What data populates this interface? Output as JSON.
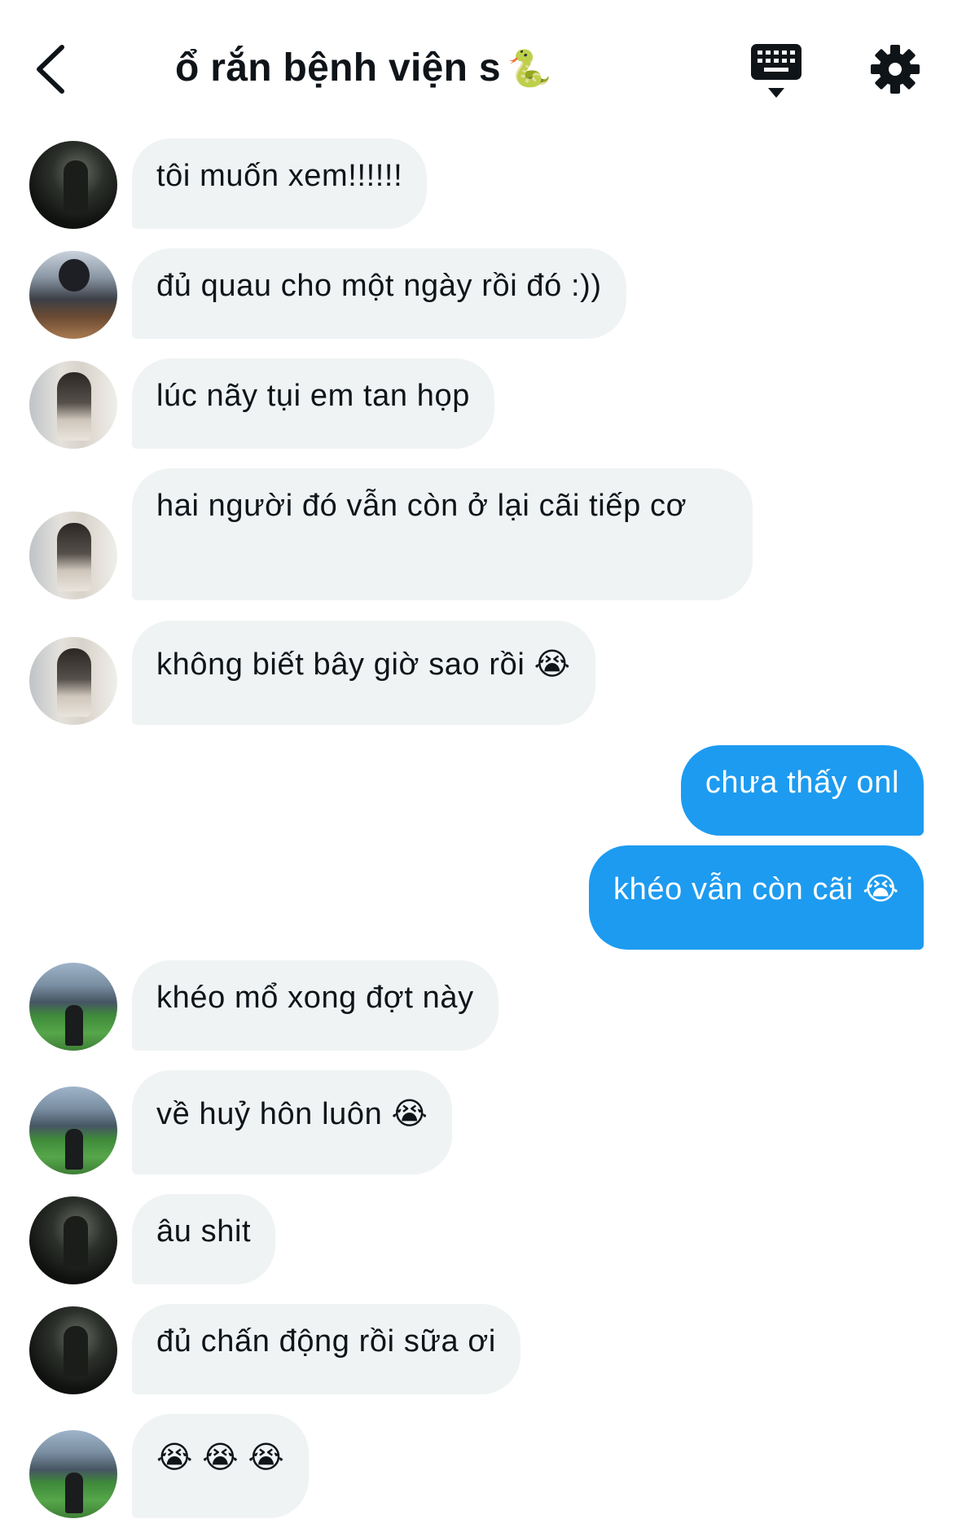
{
  "header": {
    "title": "ổ rắn bệnh viện s",
    "title_emoji": "🐍",
    "back_icon": "chevron-left-icon",
    "keyboard_icon": "keyboard-icon",
    "settings_icon": "gear-icon"
  },
  "colors": {
    "incoming_bubble": "#eff3f4",
    "outgoing_bubble": "#1d9bf0",
    "text": "#0f1419"
  },
  "messages": [
    {
      "direction": "incoming",
      "avatar": "avatar-night",
      "text": "tôi muốn xem!!!!!!"
    },
    {
      "direction": "incoming",
      "avatar": "avatar-food",
      "text": "đủ quau cho một ngày rồi đó :))"
    },
    {
      "direction": "incoming",
      "avatar": "avatar-mirror",
      "text": "lúc nãy tụi em tan họp"
    },
    {
      "direction": "incoming",
      "avatar": "avatar-mirror",
      "text": "hai người đó vẫn còn ở lại cãi tiếp cơ"
    },
    {
      "direction": "incoming",
      "avatar": "avatar-mirror",
      "text": "không biết bây giờ sao rồi 😭"
    },
    {
      "direction": "outgoing",
      "text": "chưa thấy onl"
    },
    {
      "direction": "outgoing",
      "text": "khéo vẫn còn cãi 😭"
    },
    {
      "direction": "incoming",
      "avatar": "avatar-stadium",
      "text": "khéo mổ xong đợt này"
    },
    {
      "direction": "incoming",
      "avatar": "avatar-stadium",
      "text": "về huỷ hôn luôn 😭"
    },
    {
      "direction": "incoming",
      "avatar": "avatar-night",
      "text": "âu shit"
    },
    {
      "direction": "incoming",
      "avatar": "avatar-night",
      "text": "đủ chấn động rồi sữa ơi"
    },
    {
      "direction": "incoming",
      "avatar": "avatar-stadium",
      "text": "😭 😭 😭"
    }
  ]
}
